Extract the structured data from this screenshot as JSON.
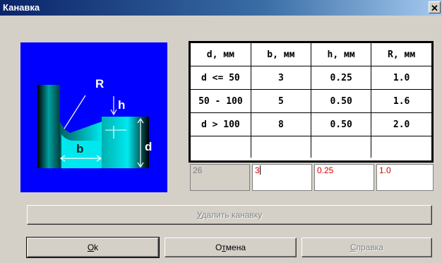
{
  "window": {
    "title": "Канавка",
    "close_glyph": "✕"
  },
  "diagram": {
    "labels": {
      "radius": "R",
      "depth": "h",
      "width": "b",
      "diameter": "d"
    },
    "colors": {
      "background": "#0000ff",
      "groove": "#00e8ee",
      "label": "#ffffff"
    }
  },
  "table": {
    "headers": [
      "d, мм",
      "b, мм",
      "h, мм",
      "R, мм"
    ],
    "rows": [
      [
        "d <= 50",
        "3",
        "0.25",
        "1.0"
      ],
      [
        "50 - 100",
        "5",
        "0.50",
        "1.6"
      ],
      [
        "d > 100",
        "8",
        "0.50",
        "2.0"
      ],
      [
        "",
        "",
        "",
        ""
      ]
    ]
  },
  "inputs": {
    "d_value": "26",
    "b_value": "3",
    "h_value": "0.25",
    "r_value": "1.0"
  },
  "buttons": {
    "delete_prefix": "У",
    "delete_rest": "далить канавку",
    "ok_prefix": "О",
    "ok_rest": "k",
    "cancel_prefix": "О",
    "cancel_mid": "т",
    "cancel_rest": "мена",
    "help_prefix": "С",
    "help_rest": "правка"
  }
}
